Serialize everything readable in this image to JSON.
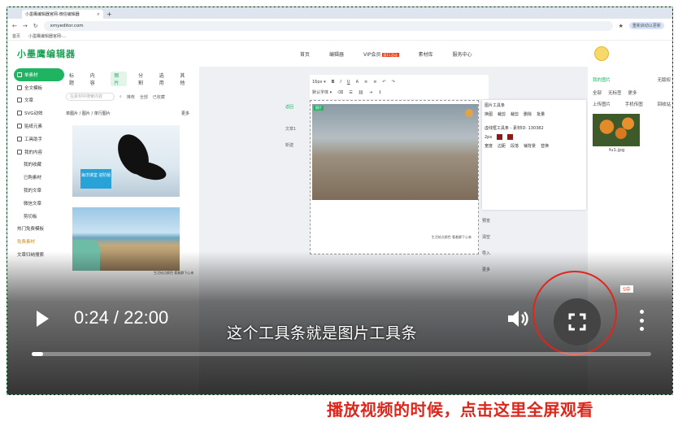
{
  "browser": {
    "tab_title": "小墨鹰编辑器官网-微信编辑器",
    "tab_close": "×",
    "new_tab": "+",
    "url": "xmyeditor.com",
    "bookmarks": [
      "首页",
      "小墨鹰编辑器官网-..."
    ],
    "all_bookmarks": "重新启动以更新"
  },
  "site": {
    "logo": "小墨鹰编辑器",
    "nav": [
      "首页",
      "编辑器",
      "VIP会员",
      "素材库",
      "服务中心"
    ],
    "vip_badge": "双11活动",
    "left_menu": [
      {
        "label": "单素材",
        "active": true
      },
      {
        "label": "全文模板"
      },
      {
        "label": "文章"
      },
      {
        "label": "SVG动效"
      },
      {
        "label": "贴纸元素"
      },
      {
        "label": "工具助手"
      },
      {
        "label": "我的内容"
      },
      {
        "label": "我的收藏",
        "sub": true
      },
      {
        "label": "已购素材",
        "sub": true
      },
      {
        "label": "我的文章",
        "sub": true
      },
      {
        "label": "微信文章",
        "sub": true
      },
      {
        "label": "剪切板",
        "sub": true
      },
      {
        "label": "热门免费模板"
      },
      {
        "label": "免费素材"
      },
      {
        "label": "文章归纳搜索"
      }
    ],
    "categories": [
      "标题",
      "内容",
      "图片",
      "分割",
      "选用",
      "其他"
    ],
    "search_placeholder": "在素材中搜索内容",
    "filters": [
      "推荐",
      "全部",
      "已收藏"
    ],
    "breadcrumb": "单图片 / 图片 / 单行图片",
    "breadcrumb_more": "更多",
    "card1_tag": "海洋课堂 进阶版",
    "card2_caption": "生活给点颜色 看着静下心来",
    "doc_label": "图片",
    "doc_caption": "生活给点颜色 看着静下心来",
    "side_buttons": [
      "返回",
      "文章1",
      "新建"
    ],
    "image_tool_title": "图片工具条",
    "image_tool_row": [
      "换图",
      "裁剪",
      "裁剪",
      "裁剪",
      "删除",
      "批量",
      "圆边框",
      "圆边距"
    ],
    "border_tool_title": "虚线框工具条 - 素材ID: 130382",
    "border_tool_rows": [
      "宽度",
      "边距",
      "段落",
      "铺背景",
      "替换",
      "边框",
      "转为图片"
    ],
    "vert_menu": [
      "预览",
      "清空",
      "导入",
      "更多"
    ],
    "right_tabs": [
      "我的图片",
      "无版权"
    ],
    "right_subtabs": [
      "全部",
      "无标签",
      "更多"
    ],
    "right_actions": [
      "上传图片",
      "手机传图",
      "回收站"
    ],
    "thumb_caption": "fu1.jpg"
  },
  "video": {
    "time": "0:24 / 22:00",
    "subtitle": "这个工具条就是图片工具条",
    "progress": 0.018,
    "ime": "S中"
  },
  "caption": "播放视频的时候，点击这里全屏观看",
  "colors": {
    "accent": "#1fb462",
    "red": "#e0251b"
  }
}
